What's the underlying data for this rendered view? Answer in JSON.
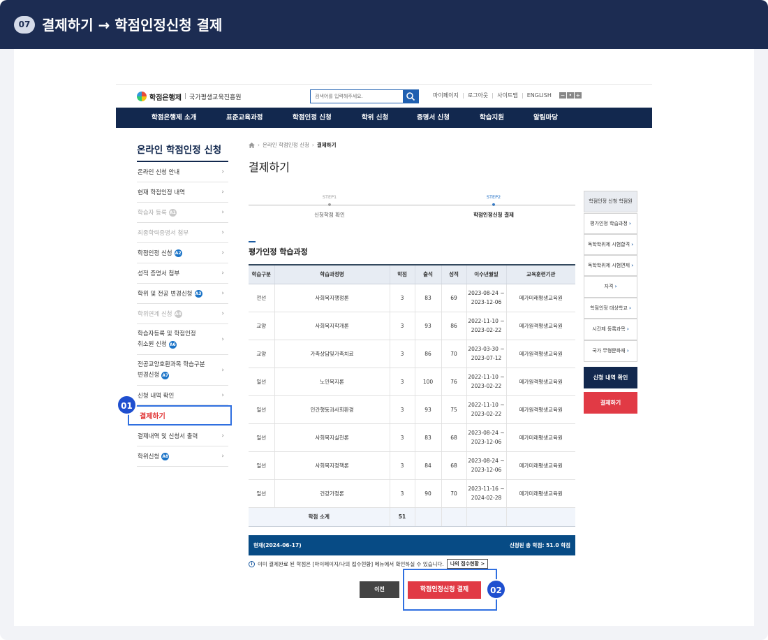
{
  "banner": {
    "step": "07",
    "title": "결제하기 → 학점인정신청 결제"
  },
  "site": {
    "logo_main": "학점은행제",
    "logo_sep": "|",
    "logo_org": "국가평생교육진흥원",
    "search_placeholder": "검색어를 입력해주세요.",
    "util_links": [
      "마이페이지",
      "로그아웃",
      "사이트맵",
      "ENGLISH"
    ],
    "zoom": [
      "−",
      "•",
      "+"
    ]
  },
  "nav": [
    "학점은행제 소개",
    "표준교육과정",
    "학점인정 신청",
    "학위 신청",
    "증명서 신청",
    "학습지원",
    "알림마당"
  ],
  "sidebar": {
    "title": "온라인 학점인정 신청",
    "items": [
      {
        "label": "온라인 신청 안내",
        "badge": "",
        "dim": false
      },
      {
        "label": "현재 학점인정 내역",
        "badge": "",
        "dim": false
      },
      {
        "label": "학습자 등록",
        "badge": "A1",
        "dim": true
      },
      {
        "label": "최종학력증명서 첨부",
        "badge": "",
        "dim": true
      },
      {
        "label": "학점인정 신청",
        "badge": "A2",
        "dim": false
      },
      {
        "label": "성적 증명서 첨부",
        "badge": "",
        "dim": false
      },
      {
        "label": "학위 및 전공 변경신청",
        "badge": "A3",
        "dim": false
      },
      {
        "label": "학위연계 신청",
        "badge": "A4",
        "dim": true
      },
      {
        "label": "학습자등록 및 학점인정",
        "label2": "취소원 신청",
        "badge": "A6",
        "dim": false
      },
      {
        "label": "전공교양호환과목 학습구분",
        "label2": "변경신청",
        "badge": "A7",
        "dim": false
      },
      {
        "label": "신청 내역 확인",
        "badge": "",
        "dim": false
      },
      {
        "label": "결제하기",
        "badge": "",
        "dim": false
      },
      {
        "label": "결제내역 및 신청서 출력",
        "badge": "",
        "dim": false
      },
      {
        "label": "학위신청",
        "badge": "A8",
        "dim": false
      }
    ]
  },
  "markers": {
    "m1": "01",
    "m2": "02"
  },
  "breadcrumb": [
    "온라인 학점인정 신청",
    "결제하기"
  ],
  "page_title": "결제하기",
  "steps": [
    {
      "step": "STEP1",
      "label": "신청학점 확인",
      "active": false
    },
    {
      "step": "STEP2",
      "label": "학점인정신청 결제",
      "active": true
    }
  ],
  "section_title": "평가인정 학습과정",
  "table": {
    "headers": [
      "학습구분",
      "학습과정명",
      "학점",
      "출석",
      "성적",
      "이수년월일",
      "교육훈련기관"
    ],
    "rows": [
      [
        "전선",
        "사회복지행정론",
        "3",
        "83",
        "69",
        "2023-08-24 ~",
        "2023-12-06",
        "메가미래평생교육원"
      ],
      [
        "교양",
        "사회복지학개론",
        "3",
        "93",
        "86",
        "2022-11-10 ~",
        "2023-02-22",
        "메가원격평생교육원"
      ],
      [
        "교양",
        "가족상담및가족치료",
        "3",
        "86",
        "70",
        "2023-03-30 ~",
        "2023-07-12",
        "메가원격평생교육원"
      ],
      [
        "일선",
        "노인복지론",
        "3",
        "100",
        "76",
        "2022-11-10 ~",
        "2023-02-22",
        "메가원격평생교육원"
      ],
      [
        "일선",
        "인간행동과사회환경",
        "3",
        "93",
        "75",
        "2022-11-10 ~",
        "2023-02-22",
        "메가원격평생교육원"
      ],
      [
        "일선",
        "사회복지실천론",
        "3",
        "83",
        "68",
        "2023-08-24 ~",
        "2023-12-06",
        "메가미래평생교육원"
      ],
      [
        "일선",
        "사회복지정책론",
        "3",
        "84",
        "68",
        "2023-08-24 ~",
        "2023-12-06",
        "메가미래평생교육원"
      ],
      [
        "일선",
        "건강가정론",
        "3",
        "90",
        "70",
        "2023-11-16 ~",
        "2024-02-28",
        "메가미래평생교육원"
      ]
    ],
    "total_label": "학점 소계",
    "total_value": "51"
  },
  "summary": {
    "left": "현재(2024-06-17)",
    "right": "신청된 총 학점: 51.0 학점"
  },
  "note": {
    "text": "이미 결제완료 된 학점은 [마이페이지/나의 접수현황] 메뉴에서 확인하실 수 있습니다.",
    "button": "나의 접수현황 >"
  },
  "buttons": {
    "prev": "이전",
    "pay": "학점인정신청 결제"
  },
  "quick": {
    "title": "학점인정 신청 학점원",
    "items": [
      "평가인정 학습과정",
      "독학학위제 시험합격",
      "독학학위제 시험면제",
      "자격",
      "학점인정 대상학교",
      "시간제 등록과목",
      "국가 무형문화재"
    ],
    "confirm": "신청 내역 확인",
    "pay": "결제하기"
  }
}
